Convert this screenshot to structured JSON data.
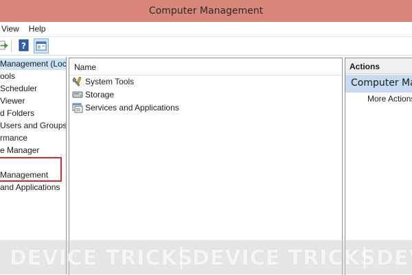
{
  "window": {
    "title": "Computer Management"
  },
  "menubar": {
    "items": [
      "View",
      "Help"
    ]
  },
  "toolbar": {
    "icons": [
      "forward-arrow-icon",
      "help-icon",
      "show-hide-console-tree-icon"
    ]
  },
  "tree": {
    "items": [
      {
        "label": "Management (Local",
        "selected": true
      },
      {
        "label": "ools"
      },
      {
        "label": "Scheduler"
      },
      {
        "label": "Viewer"
      },
      {
        "label": "d Folders"
      },
      {
        "label": "Users and Groups"
      },
      {
        "label": "rmance"
      },
      {
        "label": "e Manager"
      },
      {
        "label": ""
      },
      {
        "label": "Management",
        "highlighted": true
      },
      {
        "label": "and Applications"
      }
    ]
  },
  "list": {
    "column_header": "Name",
    "rows": [
      {
        "label": "System Tools",
        "icon": "system-tools-icon"
      },
      {
        "label": "Storage",
        "icon": "storage-icon"
      },
      {
        "label": "Services and Applications",
        "icon": "services-applications-icon"
      }
    ]
  },
  "actions": {
    "header": "Actions",
    "section_title": "Computer Management",
    "more_actions": "More Actions"
  },
  "watermark": {
    "text": "DEVICE TRICKS"
  },
  "colors": {
    "titlebar": "#d9877a",
    "selection": "#cce4f7",
    "actions_section": "#c5dcf3",
    "highlight_border": "#e0242a"
  }
}
